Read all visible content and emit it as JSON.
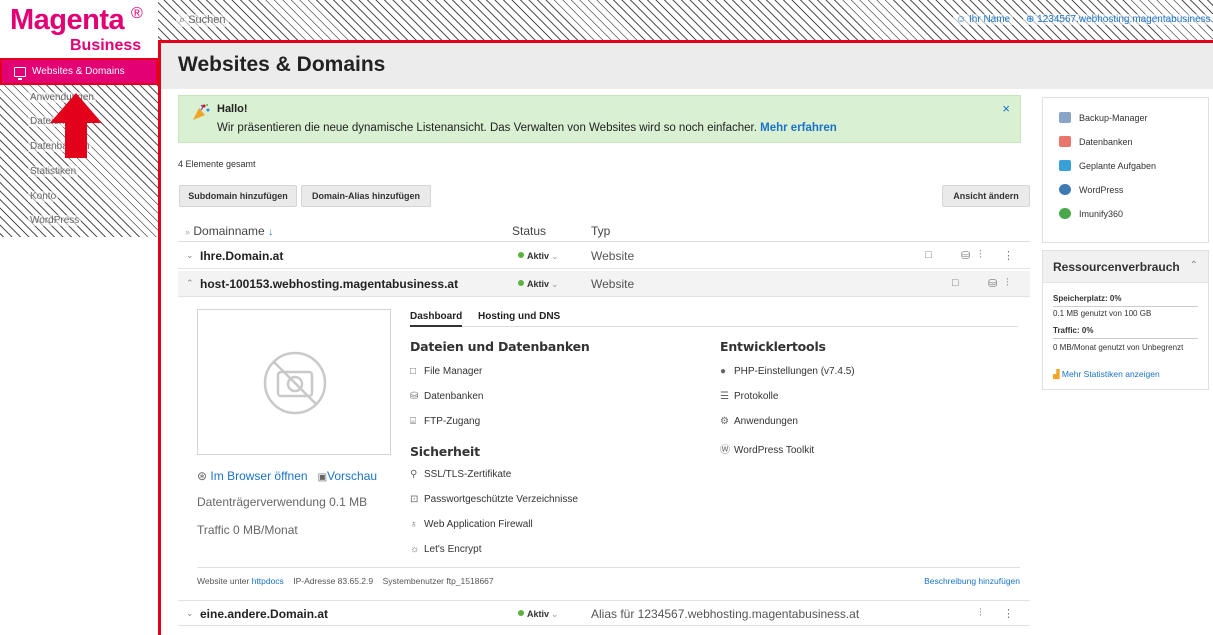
{
  "logo": {
    "brand": "Magenta",
    "reg": "®",
    "sub": "Business"
  },
  "sidebar": {
    "active": "Websites & Domains",
    "items": [
      "Anwendungen",
      "Dateien",
      "Datenbanken",
      "Statistiken",
      "Konto",
      "WordPress"
    ]
  },
  "topbar": {
    "search": "Suchen",
    "user": "Ihr Name",
    "account": "1234567.webhosting.magentabusiness.at"
  },
  "page": {
    "title": "Websites & Domains"
  },
  "notice": {
    "hallo": "Hallo!",
    "message": "Wir präsentieren die neue dynamische Listenansicht. Das Verwalten von Websites wird so noch einfacher.",
    "link": "Mehr erfahren",
    "close": "×"
  },
  "list": {
    "count": "4 Elemente gesamt",
    "btn_subdomain": "Subdomain hinzufügen",
    "btn_alias": "Domain-Alias hinzufügen",
    "btn_view": "Ansicht ändern",
    "col_name": "Domainname",
    "col_status": "Status",
    "col_type": "Typ",
    "rows": [
      {
        "name": "Ihre.Domain.at",
        "status": "Aktiv",
        "type": "Website"
      },
      {
        "name": "host-100153.webhosting.magentabusiness.at",
        "status": "Aktiv",
        "type": "Website"
      },
      {
        "name": "eine.andere.Domain.at",
        "status": "Aktiv",
        "type": "Alias für 1234567.webhosting.magentabusiness.at"
      }
    ]
  },
  "detail": {
    "tab_dashboard": "Dashboard",
    "tab_hosting": "Hosting und DNS",
    "browser": "Im Browser öffnen",
    "preview": "Vorschau",
    "disk": "Datenträgerverwendung 0.1 MB",
    "traffic": "Traffic 0 MB/Monat",
    "files_title": "Dateien und Datenbanken",
    "file_manager": "File Manager",
    "databases": "Datenbanken",
    "ftp": "FTP-Zugang",
    "security_title": "Sicherheit",
    "ssl": "SSL/TLS-Zertifikate",
    "protected_dirs": "Passwortgeschützte Verzeichnisse",
    "waf": "Web Application Firewall",
    "letsencrypt": "Let's Encrypt",
    "dev_title": "Entwicklertools",
    "php": "PHP-Einstellungen (v7.4.5)",
    "logs": "Protokolle",
    "apps": "Anwendungen",
    "wp_toolkit": "WordPress Toolkit",
    "foot_site_label": "Website unter",
    "foot_site_link": "httpdocs",
    "foot_ip": "IP-Adresse 83.65.2.9",
    "foot_user": "Systembenutzer ftp_1518667",
    "foot_desc": "Beschreibung hinzufügen"
  },
  "tools": [
    "Backup-Manager",
    "Datenbanken",
    "Geplante Aufgaben",
    "WordPress",
    "Imunify360"
  ],
  "resources": {
    "title": "Ressourcenverbrauch",
    "storage_label": "Speicherplatz: 0%",
    "storage_detail": "0.1 MB genutzt von 100 GB",
    "traffic_label": "Traffic: 0%",
    "traffic_detail": "0 MB/Monat genutzt von Unbegrenzt",
    "more": "Mehr Statistiken anzeigen"
  }
}
